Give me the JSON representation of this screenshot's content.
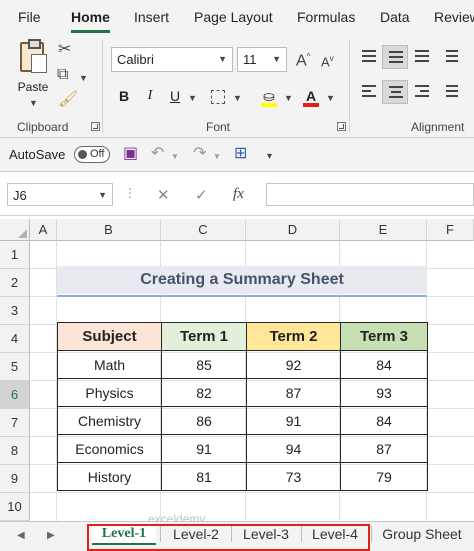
{
  "menu": {
    "tabs": [
      "File",
      "Home",
      "Insert",
      "Page Layout",
      "Formulas",
      "Data",
      "Review"
    ],
    "active": "Home"
  },
  "ribbon": {
    "clipboard": {
      "paste_label": "Paste",
      "group_label": "Clipboard"
    },
    "font": {
      "font_name": "Calibri",
      "font_size": "11",
      "group_label": "Font",
      "bold": "B",
      "italic": "I",
      "underline": "U",
      "fill_color": "#ffff00",
      "font_color": "#e0201b"
    },
    "alignment": {
      "group_label": "Alignment"
    }
  },
  "qat": {
    "autosave_label": "AutoSave",
    "autosave_state": "Off"
  },
  "formula_bar": {
    "name_box": "J6",
    "fx": "fx",
    "formula": ""
  },
  "grid": {
    "columns": [
      "A",
      "B",
      "C",
      "D",
      "E",
      "F"
    ],
    "rows": [
      "1",
      "2",
      "3",
      "4",
      "5",
      "6",
      "7",
      "8",
      "9",
      "10"
    ],
    "selected_row": "6",
    "title": "Creating a Summary Sheet",
    "table": {
      "headers": [
        "Subject",
        "Term 1",
        "Term 2",
        "Term 3"
      ],
      "header_colors": [
        "#fce4d6",
        "#e2efda",
        "#ffe699",
        "#c6e0b4"
      ],
      "rows": [
        [
          "Math",
          "85",
          "92",
          "84"
        ],
        [
          "Physics",
          "82",
          "87",
          "93"
        ],
        [
          "Chemistry",
          "86",
          "91",
          "84"
        ],
        [
          "Economics",
          "91",
          "94",
          "87"
        ],
        [
          "History",
          "81",
          "73",
          "79"
        ]
      ]
    },
    "watermark": "exceldemy"
  },
  "sheets": {
    "tabs": [
      "Level-1",
      "Level-2",
      "Level-3",
      "Level-4",
      "Group Sheet"
    ],
    "active": "Level-1"
  },
  "colors": {
    "accent": "#217346",
    "highlight_box": "#e0201b",
    "title_text": "#44546a"
  }
}
